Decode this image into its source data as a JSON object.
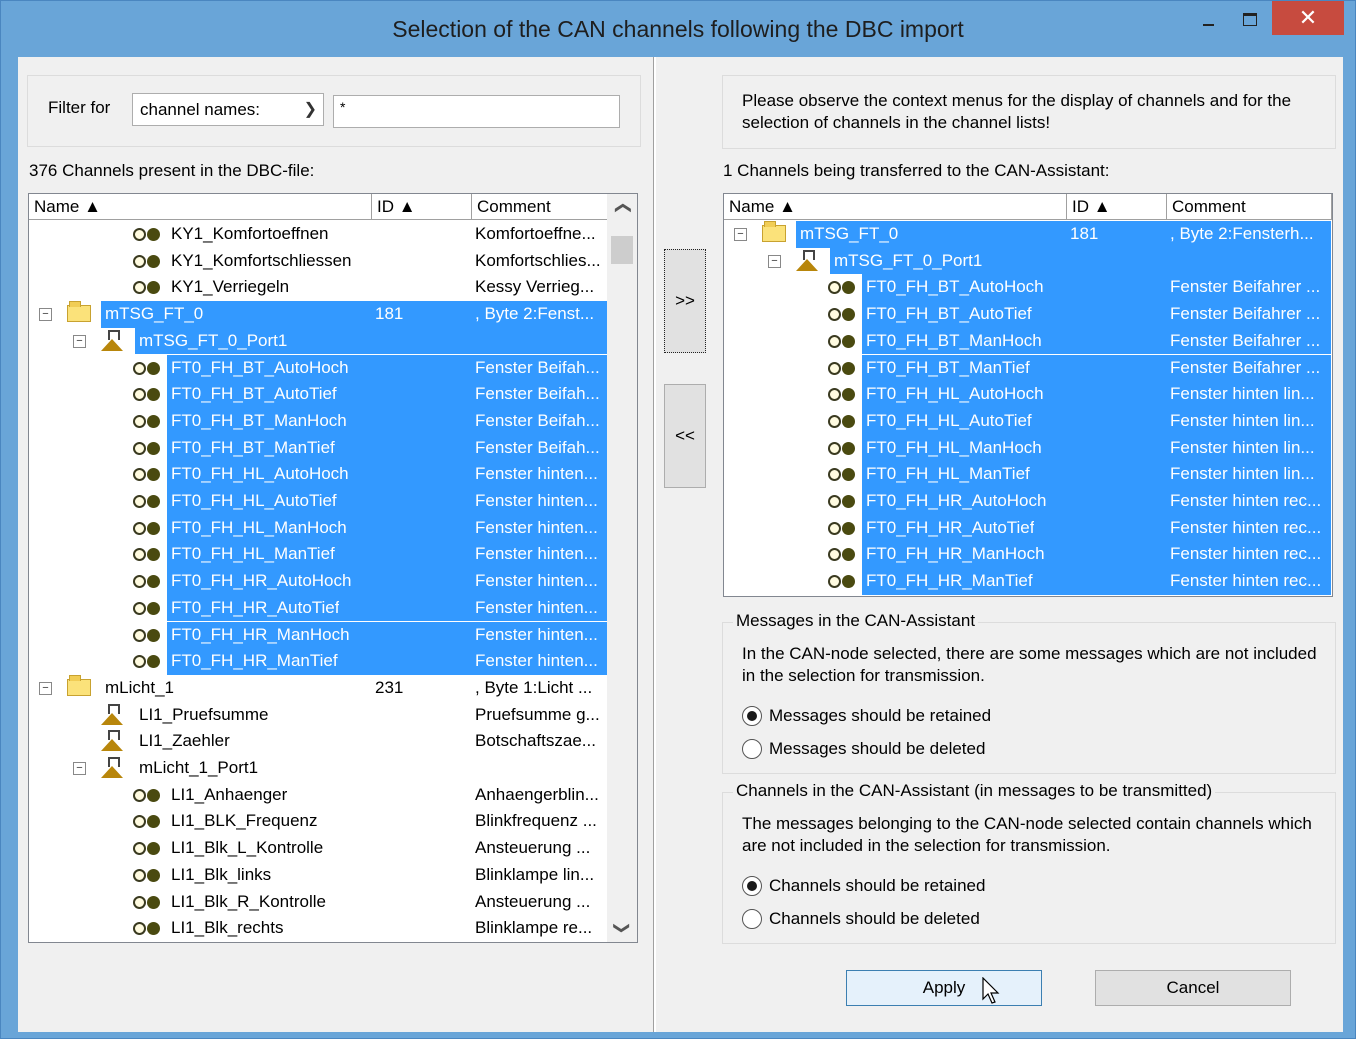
{
  "window": {
    "title": "Selection of the CAN channels following the DBC import",
    "close_glyph": "✕"
  },
  "filter": {
    "label": "Filter for",
    "combo_value": "channel names:",
    "input_value": "*"
  },
  "left_list": {
    "caption": "376 Channels present in the DBC-file:",
    "headers": [
      "Name ▲",
      "ID ▲",
      "Comment"
    ],
    "rows": [
      {
        "kind": "channel",
        "name": "KY1_Komfortoeffnen",
        "id": "",
        "comment": "Komfortoeffne...",
        "selected": false
      },
      {
        "kind": "channel",
        "name": "KY1_Komfortschliessen",
        "id": "",
        "comment": "Komfortschlies...",
        "selected": false
      },
      {
        "kind": "channel",
        "name": "KY1_Verriegeln",
        "id": "",
        "comment": "Kessy Verrieg...",
        "selected": false
      },
      {
        "kind": "message",
        "name": "mTSG_FT_0",
        "id": "181",
        "comment": ", Byte 2:Fenst...",
        "selected": true
      },
      {
        "kind": "port",
        "name": "mTSG_FT_0_Port1",
        "id": "",
        "comment": "",
        "selected": true
      },
      {
        "kind": "channel",
        "name": "FT0_FH_BT_AutoHoch",
        "id": "",
        "comment": "Fenster Beifah...",
        "selected": true
      },
      {
        "kind": "channel",
        "name": "FT0_FH_BT_AutoTief",
        "id": "",
        "comment": "Fenster Beifah...",
        "selected": true
      },
      {
        "kind": "channel",
        "name": "FT0_FH_BT_ManHoch",
        "id": "",
        "comment": "Fenster Beifah...",
        "selected": true
      },
      {
        "kind": "channel",
        "name": "FT0_FH_BT_ManTief",
        "id": "",
        "comment": "Fenster Beifah...",
        "selected": true
      },
      {
        "kind": "channel",
        "name": "FT0_FH_HL_AutoHoch",
        "id": "",
        "comment": "Fenster hinten...",
        "selected": true
      },
      {
        "kind": "channel",
        "name": "FT0_FH_HL_AutoTief",
        "id": "",
        "comment": "Fenster hinten...",
        "selected": true
      },
      {
        "kind": "channel",
        "name": "FT0_FH_HL_ManHoch",
        "id": "",
        "comment": "Fenster hinten...",
        "selected": true
      },
      {
        "kind": "channel",
        "name": "FT0_FH_HL_ManTief",
        "id": "",
        "comment": "Fenster hinten...",
        "selected": true
      },
      {
        "kind": "channel",
        "name": "FT0_FH_HR_AutoHoch",
        "id": "",
        "comment": "Fenster hinten...",
        "selected": true
      },
      {
        "kind": "channel",
        "name": "FT0_FH_HR_AutoTief",
        "id": "",
        "comment": "Fenster hinten...",
        "selected": true
      },
      {
        "kind": "channel",
        "name": "FT0_FH_HR_ManHoch",
        "id": "",
        "comment": "Fenster hinten...",
        "selected": true
      },
      {
        "kind": "channel",
        "name": "FT0_FH_HR_ManTief",
        "id": "",
        "comment": "Fenster hinten...",
        "selected": true
      },
      {
        "kind": "message",
        "name": "mLicht_1",
        "id": "231",
        "comment": ", Byte 1:Licht ...",
        "selected": false
      },
      {
        "kind": "port-leaf",
        "name": "LI1_Pruefsumme",
        "id": "",
        "comment": "Pruefsumme g...",
        "selected": false
      },
      {
        "kind": "port-leaf",
        "name": "LI1_Zaehler",
        "id": "",
        "comment": "Botschaftszae...",
        "selected": false
      },
      {
        "kind": "port",
        "name": "mLicht_1_Port1",
        "id": "",
        "comment": "",
        "selected": false
      },
      {
        "kind": "channel",
        "name": "LI1_Anhaenger",
        "id": "",
        "comment": "Anhaengerblin...",
        "selected": false
      },
      {
        "kind": "channel",
        "name": "LI1_BLK_Frequenz",
        "id": "",
        "comment": "Blinkfrequenz ...",
        "selected": false
      },
      {
        "kind": "channel",
        "name": "LI1_Blk_L_Kontrolle",
        "id": "",
        "comment": "Ansteuerung ...",
        "selected": false
      },
      {
        "kind": "channel",
        "name": "LI1_Blk_links",
        "id": "",
        "comment": "Blinklampe lin...",
        "selected": false
      },
      {
        "kind": "channel",
        "name": "LI1_Blk_R_Kontrolle",
        "id": "",
        "comment": "Ansteuerung ...",
        "selected": false
      },
      {
        "kind": "channel",
        "name": "LI1_Blk_rechts",
        "id": "",
        "comment": "Blinklampe re...",
        "selected": false
      }
    ]
  },
  "transfer": {
    "add_label": ">>",
    "remove_label": "<<"
  },
  "info": {
    "text": "Please observe the context menus for the display of channels and for the selection of channels in the channel lists!"
  },
  "right_list": {
    "caption": "1 Channels being transferred to the CAN-Assistant:",
    "headers": [
      "Name ▲",
      "ID ▲",
      "Comment"
    ],
    "rows": [
      {
        "kind": "message",
        "name": "mTSG_FT_0",
        "id": "181",
        "comment": ", Byte 2:Fensterh...",
        "selected": true
      },
      {
        "kind": "port",
        "name": "mTSG_FT_0_Port1",
        "id": "",
        "comment": "",
        "selected": true
      },
      {
        "kind": "channel",
        "name": "FT0_FH_BT_AutoHoch",
        "id": "",
        "comment": "Fenster Beifahrer ...",
        "selected": true
      },
      {
        "kind": "channel",
        "name": "FT0_FH_BT_AutoTief",
        "id": "",
        "comment": "Fenster Beifahrer ...",
        "selected": true
      },
      {
        "kind": "channel",
        "name": "FT0_FH_BT_ManHoch",
        "id": "",
        "comment": "Fenster Beifahrer ...",
        "selected": true
      },
      {
        "kind": "channel",
        "name": "FT0_FH_BT_ManTief",
        "id": "",
        "comment": "Fenster Beifahrer ...",
        "selected": true
      },
      {
        "kind": "channel",
        "name": "FT0_FH_HL_AutoHoch",
        "id": "",
        "comment": "Fenster hinten lin...",
        "selected": true
      },
      {
        "kind": "channel",
        "name": "FT0_FH_HL_AutoTief",
        "id": "",
        "comment": "Fenster hinten lin...",
        "selected": true
      },
      {
        "kind": "channel",
        "name": "FT0_FH_HL_ManHoch",
        "id": "",
        "comment": "Fenster hinten lin...",
        "selected": true
      },
      {
        "kind": "channel",
        "name": "FT0_FH_HL_ManTief",
        "id": "",
        "comment": "Fenster hinten lin...",
        "selected": true
      },
      {
        "kind": "channel",
        "name": "FT0_FH_HR_AutoHoch",
        "id": "",
        "comment": "Fenster hinten rec...",
        "selected": true
      },
      {
        "kind": "channel",
        "name": "FT0_FH_HR_AutoTief",
        "id": "",
        "comment": "Fenster hinten rec...",
        "selected": true
      },
      {
        "kind": "channel",
        "name": "FT0_FH_HR_ManHoch",
        "id": "",
        "comment": "Fenster hinten rec...",
        "selected": true
      },
      {
        "kind": "channel",
        "name": "FT0_FH_HR_ManTief",
        "id": "",
        "comment": "Fenster hinten rec...",
        "selected": true
      }
    ]
  },
  "messages_group": {
    "legend": "Messages in the CAN-Assistant",
    "text": "In the CAN-node selected, there are some messages which are not included in the selection for transmission.",
    "option_retain": "Messages should be retained",
    "option_delete": "Messages should be deleted",
    "selected": "retain"
  },
  "channels_group": {
    "legend": "Channels in the CAN-Assistant (in messages to be transmitted)",
    "text": "The messages belonging to the CAN-node selected contain channels which are not included in the selection for transmission.",
    "option_retain": "Channels should be retained",
    "option_delete": "Channels should be deleted",
    "selected": "retain"
  },
  "buttons": {
    "apply": "Apply",
    "cancel": "Cancel"
  },
  "colors": {
    "selection": "#3399ff",
    "title_bar": "#69a5d8",
    "close": "#c74b3f"
  }
}
